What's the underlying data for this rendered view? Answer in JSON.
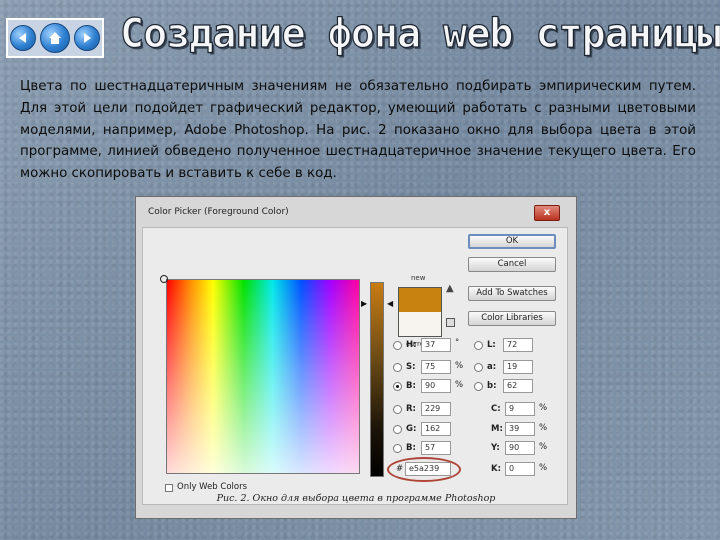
{
  "nav": {
    "back_icon": "arrow-left-icon",
    "home_icon": "home-icon",
    "forward_icon": "arrow-right-icon"
  },
  "slide": {
    "title": "Создание фона web страницы",
    "paragraph": "Цвета по шестнадцатеричным значениям не обязательно подбирать эмпирическим путем. Для этой цели подойдет графический редактор, умеющий работать с разными цветовыми моделями, например, Adobe Photoshop. На рис. 2 показано окно для выбора цвета в этой программе, линией обведено полученное шестнадцатеричное значение текущего цвета. Его можно скопировать и вставить к себе в код."
  },
  "dialog": {
    "title": "Color Picker (Foreground Color)",
    "close_label": "x",
    "new_label": "new",
    "current_label": "current",
    "new_color": "#c8820f",
    "current_color": "#f7f3ee",
    "buttons": {
      "ok": "OK",
      "cancel": "Cancel",
      "add_to_swatches": "Add To Swatches",
      "color_libraries": "Color Libraries"
    },
    "fields": {
      "h": {
        "label": "H:",
        "value": "37",
        "unit": "°"
      },
      "s": {
        "label": "S:",
        "value": "75",
        "unit": "%"
      },
      "b": {
        "label": "B:",
        "value": "90",
        "unit": "%"
      },
      "r": {
        "label": "R:",
        "value": "229"
      },
      "g": {
        "label": "G:",
        "value": "162"
      },
      "bb": {
        "label": "B:",
        "value": "57"
      },
      "l": {
        "label": "L:",
        "value": "72"
      },
      "a": {
        "label": "a:",
        "value": "19"
      },
      "lab_b": {
        "label": "b:",
        "value": "62"
      },
      "c": {
        "label": "C:",
        "value": "9",
        "unit": "%"
      },
      "m": {
        "label": "M:",
        "value": "39",
        "unit": "%"
      },
      "y": {
        "label": "Y:",
        "value": "90",
        "unit": "%"
      },
      "k": {
        "label": "K:",
        "value": "0",
        "unit": "%"
      }
    },
    "hex_label": "#",
    "hex_value": "e5a239",
    "only_web_colors": "Only Web Colors",
    "caption": "Рис. 2. Окно для выбора цвета в программе Photoshop"
  }
}
